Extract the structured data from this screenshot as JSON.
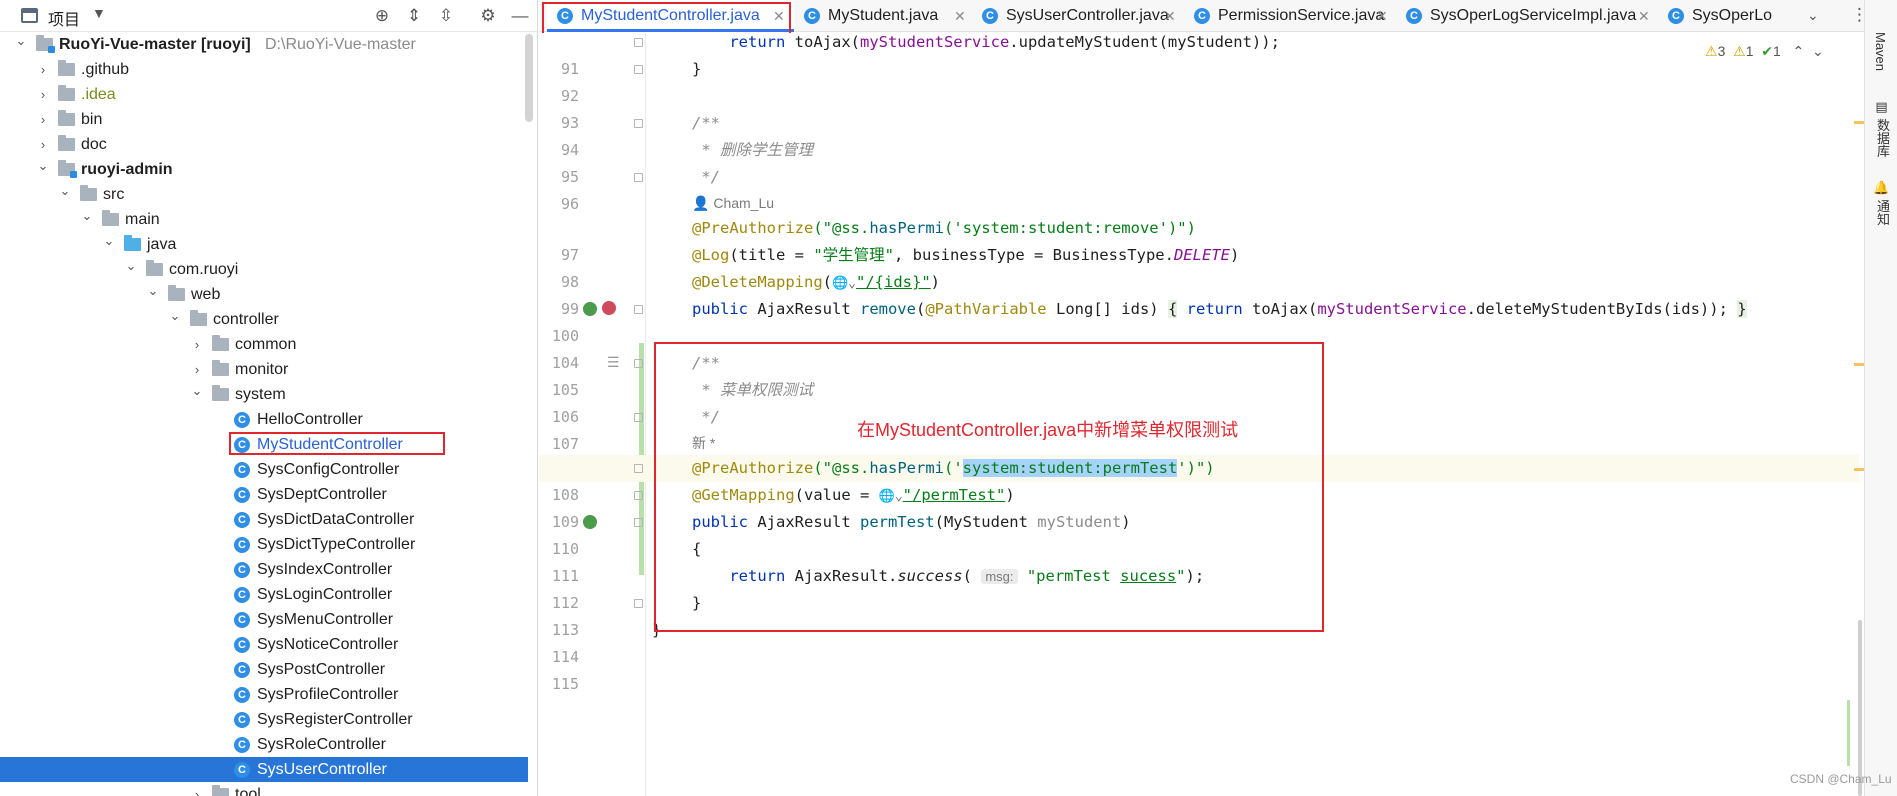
{
  "project_panel": {
    "title": "项目",
    "tree": [
      {
        "label": "RuoYi-Vue-master [ruoyi]",
        "path": "D:\\RuoYi-Vue-master",
        "icon": "module",
        "expanded": true
      },
      {
        "label": ".github",
        "icon": "folder",
        "expanded": false
      },
      {
        "label": ".idea",
        "icon": "folder",
        "expanded": false
      },
      {
        "label": "bin",
        "icon": "folder",
        "expanded": false
      },
      {
        "label": "doc",
        "icon": "folder",
        "expanded": false
      },
      {
        "label": "ruoyi-admin",
        "icon": "module",
        "expanded": true
      },
      {
        "label": "src",
        "icon": "folder",
        "expanded": true
      },
      {
        "label": "main",
        "icon": "folder",
        "expanded": true
      },
      {
        "label": "java",
        "icon": "source-folder",
        "expanded": true
      },
      {
        "label": "com.ruoyi",
        "icon": "package",
        "expanded": true
      },
      {
        "label": "web",
        "icon": "package",
        "expanded": true
      },
      {
        "label": "controller",
        "icon": "package",
        "expanded": true
      },
      {
        "label": "common",
        "icon": "package",
        "expanded": false
      },
      {
        "label": "monitor",
        "icon": "package",
        "expanded": false
      },
      {
        "label": "system",
        "icon": "package",
        "expanded": true
      },
      {
        "label": "HelloController",
        "icon": "class"
      },
      {
        "label": "MyStudentController",
        "icon": "class"
      },
      {
        "label": "SysConfigController",
        "icon": "class"
      },
      {
        "label": "SysDeptController",
        "icon": "class"
      },
      {
        "label": "SysDictDataController",
        "icon": "class"
      },
      {
        "label": "SysDictTypeController",
        "icon": "class"
      },
      {
        "label": "SysIndexController",
        "icon": "class"
      },
      {
        "label": "SysLoginController",
        "icon": "class"
      },
      {
        "label": "SysMenuController",
        "icon": "class"
      },
      {
        "label": "SysNoticeController",
        "icon": "class"
      },
      {
        "label": "SysPostController",
        "icon": "class"
      },
      {
        "label": "SysProfileController",
        "icon": "class"
      },
      {
        "label": "SysRegisterController",
        "icon": "class"
      },
      {
        "label": "SysRoleController",
        "icon": "class"
      },
      {
        "label": "SysUserController",
        "icon": "class",
        "selected": true
      },
      {
        "label": "tool",
        "icon": "package",
        "expanded": false
      }
    ]
  },
  "tabs": [
    {
      "label": "MyStudentController.java",
      "active": true
    },
    {
      "label": "MyStudent.java"
    },
    {
      "label": "SysUserController.java"
    },
    {
      "label": "PermissionService.java"
    },
    {
      "label": "SysOperLogServiceImpl.java"
    },
    {
      "label": "SysOperLo"
    }
  ],
  "inspections": {
    "warnings": "3",
    "weak_warnings": "1",
    "ok": "1"
  },
  "editor": {
    "author_hint": "Cham_Lu",
    "new_hint": "新 *",
    "lines": {
      "l91": "91",
      "l92": "92",
      "l93": "93",
      "l94": "94",
      "l95": "95",
      "l96": "96",
      "l97": "97",
      "l98": "98",
      "l99": "99",
      "l100": "100",
      "l104": "104",
      "l105": "105",
      "l106": "106",
      "l107": "107",
      "l108": "108",
      "l109": "109",
      "l110": "110",
      "l111": "111",
      "l112": "112",
      "l113": "113",
      "l114": "114",
      "l115": "115"
    },
    "code": {
      "c91_return": "return",
      "c91_rest": " toAjax(",
      "c91_field": "myStudentService",
      "c91_tail": ".updateMyStudent(myStudent));",
      "brace_close": "}",
      "brace_open": "{",
      "javadoc_open": "/**",
      "javadoc_close": " */",
      "c95_comment": " * 删除学生管理",
      "c97_ann": "@PreAuthorize",
      "c97_str1": "(\"@ss.",
      "c97_fn": "hasPermi",
      "c97_str2": "('system:student:remove')\")",
      "c98_ann": "@Log",
      "c98_rest1": "(title = ",
      "c98_str": "\"学生管理\"",
      "c98_rest2": ", businessType = BusinessType.",
      "c98_const": "DELETE",
      "c98_close": ")",
      "c99_ann": "@DeleteMapping",
      "c99_paren": "(",
      "c99_str": "\"/{ids}\"",
      "c99_close": ")",
      "c100_public": "public",
      "c100_type": " AjaxResult ",
      "c100_fn": "remove",
      "c100_paren": "(",
      "c100_ann": "@PathVariable",
      "c100_params": " Long[] ids) ",
      "c100_brace": "{",
      "c100_return": " return",
      "c100_call": " toAjax(",
      "c100_field": "myStudentService",
      "c100_tail": ".deleteMyStudentByIds(ids)); ",
      "c100_end": "}",
      "c106_comment": " * 菜单权限测试",
      "c108_ann": "@PreAuthorize",
      "c108_str1": "(\"@ss.",
      "c108_fn": "hasPermi",
      "c108_str2": "('",
      "c108_sel": "system:student:permTest",
      "c108_str3": "')\")",
      "c109_ann": "@GetMapping",
      "c109_rest": "(value = ",
      "c109_str": "\"/permTest\"",
      "c109_close": ")",
      "c110_public": "public",
      "c110_type": " AjaxResult ",
      "c110_fn": "permTest",
      "c110_params": "(MyStudent ",
      "c110_pname": "myStudent",
      "c110_close": ")",
      "c112_return": "return",
      "c112_call": " AjaxResult.",
      "c112_fn": "success",
      "c112_paren": "(",
      "c112_inlay": "msg:",
      "c112_str1": "\"permTest ",
      "c112_str2": "sucess",
      "c112_str3": "\"",
      "c112_tail": ");"
    }
  },
  "annotation": {
    "text": "在MyStudentController.java中新增菜单权限测试"
  },
  "right_tools": [
    "Maven",
    "数据库",
    "通知"
  ],
  "watermark": "CSDN @Cham_Lu",
  "colors": {
    "accent": "#2675d7",
    "annotation_red": "#e0262e",
    "keyword": "#0033b3",
    "string": "#067d17",
    "annotation": "#9e880d"
  }
}
